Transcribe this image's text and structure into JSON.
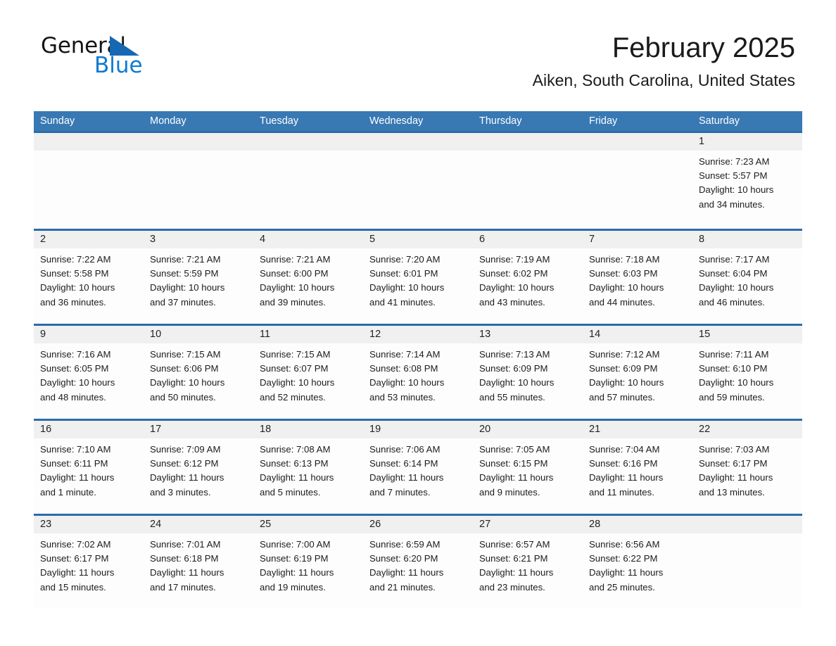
{
  "brand": {
    "name_part1": "General",
    "name_part2": "Blue",
    "triangle_color": "#1668b3",
    "blue_color": "#0f7ad1"
  },
  "header": {
    "title": "February 2025",
    "subtitle": "Aiken, South Carolina, United States"
  },
  "theme": {
    "header_blue": "#3879b4",
    "row_divider_blue": "#2c6ca8",
    "day_head_gray": "#f0f0f0"
  },
  "weekdays": [
    "Sunday",
    "Monday",
    "Tuesday",
    "Wednesday",
    "Thursday",
    "Friday",
    "Saturday"
  ],
  "weeks": [
    [
      {
        "day": "",
        "sunrise": "",
        "sunset": "",
        "daylight_line1": "",
        "daylight_line2": ""
      },
      {
        "day": "",
        "sunrise": "",
        "sunset": "",
        "daylight_line1": "",
        "daylight_line2": ""
      },
      {
        "day": "",
        "sunrise": "",
        "sunset": "",
        "daylight_line1": "",
        "daylight_line2": ""
      },
      {
        "day": "",
        "sunrise": "",
        "sunset": "",
        "daylight_line1": "",
        "daylight_line2": ""
      },
      {
        "day": "",
        "sunrise": "",
        "sunset": "",
        "daylight_line1": "",
        "daylight_line2": ""
      },
      {
        "day": "",
        "sunrise": "",
        "sunset": "",
        "daylight_line1": "",
        "daylight_line2": ""
      },
      {
        "day": "1",
        "sunrise": "Sunrise: 7:23 AM",
        "sunset": "Sunset: 5:57 PM",
        "daylight_line1": "Daylight: 10 hours",
        "daylight_line2": "and 34 minutes."
      }
    ],
    [
      {
        "day": "2",
        "sunrise": "Sunrise: 7:22 AM",
        "sunset": "Sunset: 5:58 PM",
        "daylight_line1": "Daylight: 10 hours",
        "daylight_line2": "and 36 minutes."
      },
      {
        "day": "3",
        "sunrise": "Sunrise: 7:21 AM",
        "sunset": "Sunset: 5:59 PM",
        "daylight_line1": "Daylight: 10 hours",
        "daylight_line2": "and 37 minutes."
      },
      {
        "day": "4",
        "sunrise": "Sunrise: 7:21 AM",
        "sunset": "Sunset: 6:00 PM",
        "daylight_line1": "Daylight: 10 hours",
        "daylight_line2": "and 39 minutes."
      },
      {
        "day": "5",
        "sunrise": "Sunrise: 7:20 AM",
        "sunset": "Sunset: 6:01 PM",
        "daylight_line1": "Daylight: 10 hours",
        "daylight_line2": "and 41 minutes."
      },
      {
        "day": "6",
        "sunrise": "Sunrise: 7:19 AM",
        "sunset": "Sunset: 6:02 PM",
        "daylight_line1": "Daylight: 10 hours",
        "daylight_line2": "and 43 minutes."
      },
      {
        "day": "7",
        "sunrise": "Sunrise: 7:18 AM",
        "sunset": "Sunset: 6:03 PM",
        "daylight_line1": "Daylight: 10 hours",
        "daylight_line2": "and 44 minutes."
      },
      {
        "day": "8",
        "sunrise": "Sunrise: 7:17 AM",
        "sunset": "Sunset: 6:04 PM",
        "daylight_line1": "Daylight: 10 hours",
        "daylight_line2": "and 46 minutes."
      }
    ],
    [
      {
        "day": "9",
        "sunrise": "Sunrise: 7:16 AM",
        "sunset": "Sunset: 6:05 PM",
        "daylight_line1": "Daylight: 10 hours",
        "daylight_line2": "and 48 minutes."
      },
      {
        "day": "10",
        "sunrise": "Sunrise: 7:15 AM",
        "sunset": "Sunset: 6:06 PM",
        "daylight_line1": "Daylight: 10 hours",
        "daylight_line2": "and 50 minutes."
      },
      {
        "day": "11",
        "sunrise": "Sunrise: 7:15 AM",
        "sunset": "Sunset: 6:07 PM",
        "daylight_line1": "Daylight: 10 hours",
        "daylight_line2": "and 52 minutes."
      },
      {
        "day": "12",
        "sunrise": "Sunrise: 7:14 AM",
        "sunset": "Sunset: 6:08 PM",
        "daylight_line1": "Daylight: 10 hours",
        "daylight_line2": "and 53 minutes."
      },
      {
        "day": "13",
        "sunrise": "Sunrise: 7:13 AM",
        "sunset": "Sunset: 6:09 PM",
        "daylight_line1": "Daylight: 10 hours",
        "daylight_line2": "and 55 minutes."
      },
      {
        "day": "14",
        "sunrise": "Sunrise: 7:12 AM",
        "sunset": "Sunset: 6:09 PM",
        "daylight_line1": "Daylight: 10 hours",
        "daylight_line2": "and 57 minutes."
      },
      {
        "day": "15",
        "sunrise": "Sunrise: 7:11 AM",
        "sunset": "Sunset: 6:10 PM",
        "daylight_line1": "Daylight: 10 hours",
        "daylight_line2": "and 59 minutes."
      }
    ],
    [
      {
        "day": "16",
        "sunrise": "Sunrise: 7:10 AM",
        "sunset": "Sunset: 6:11 PM",
        "daylight_line1": "Daylight: 11 hours",
        "daylight_line2": "and 1 minute."
      },
      {
        "day": "17",
        "sunrise": "Sunrise: 7:09 AM",
        "sunset": "Sunset: 6:12 PM",
        "daylight_line1": "Daylight: 11 hours",
        "daylight_line2": "and 3 minutes."
      },
      {
        "day": "18",
        "sunrise": "Sunrise: 7:08 AM",
        "sunset": "Sunset: 6:13 PM",
        "daylight_line1": "Daylight: 11 hours",
        "daylight_line2": "and 5 minutes."
      },
      {
        "day": "19",
        "sunrise": "Sunrise: 7:06 AM",
        "sunset": "Sunset: 6:14 PM",
        "daylight_line1": "Daylight: 11 hours",
        "daylight_line2": "and 7 minutes."
      },
      {
        "day": "20",
        "sunrise": "Sunrise: 7:05 AM",
        "sunset": "Sunset: 6:15 PM",
        "daylight_line1": "Daylight: 11 hours",
        "daylight_line2": "and 9 minutes."
      },
      {
        "day": "21",
        "sunrise": "Sunrise: 7:04 AM",
        "sunset": "Sunset: 6:16 PM",
        "daylight_line1": "Daylight: 11 hours",
        "daylight_line2": "and 11 minutes."
      },
      {
        "day": "22",
        "sunrise": "Sunrise: 7:03 AM",
        "sunset": "Sunset: 6:17 PM",
        "daylight_line1": "Daylight: 11 hours",
        "daylight_line2": "and 13 minutes."
      }
    ],
    [
      {
        "day": "23",
        "sunrise": "Sunrise: 7:02 AM",
        "sunset": "Sunset: 6:17 PM",
        "daylight_line1": "Daylight: 11 hours",
        "daylight_line2": "and 15 minutes."
      },
      {
        "day": "24",
        "sunrise": "Sunrise: 7:01 AM",
        "sunset": "Sunset: 6:18 PM",
        "daylight_line1": "Daylight: 11 hours",
        "daylight_line2": "and 17 minutes."
      },
      {
        "day": "25",
        "sunrise": "Sunrise: 7:00 AM",
        "sunset": "Sunset: 6:19 PM",
        "daylight_line1": "Daylight: 11 hours",
        "daylight_line2": "and 19 minutes."
      },
      {
        "day": "26",
        "sunrise": "Sunrise: 6:59 AM",
        "sunset": "Sunset: 6:20 PM",
        "daylight_line1": "Daylight: 11 hours",
        "daylight_line2": "and 21 minutes."
      },
      {
        "day": "27",
        "sunrise": "Sunrise: 6:57 AM",
        "sunset": "Sunset: 6:21 PM",
        "daylight_line1": "Daylight: 11 hours",
        "daylight_line2": "and 23 minutes."
      },
      {
        "day": "28",
        "sunrise": "Sunrise: 6:56 AM",
        "sunset": "Sunset: 6:22 PM",
        "daylight_line1": "Daylight: 11 hours",
        "daylight_line2": "and 25 minutes."
      },
      {
        "day": "",
        "sunrise": "",
        "sunset": "",
        "daylight_line1": "",
        "daylight_line2": ""
      }
    ]
  ]
}
